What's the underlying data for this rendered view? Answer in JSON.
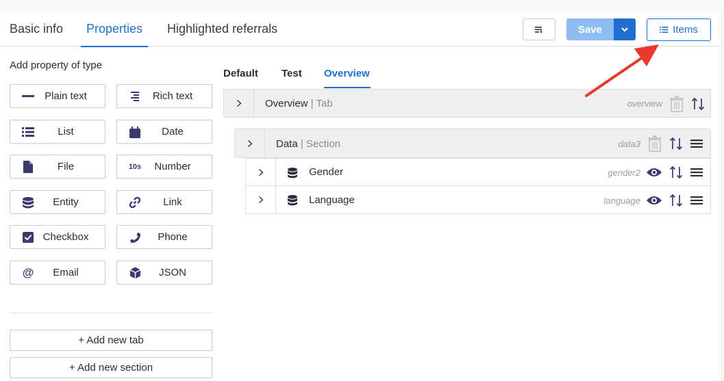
{
  "top_tabs": [
    "Basic info",
    "Properties",
    "Highlighted referrals"
  ],
  "toolbar": {
    "save_label": "Save",
    "items_label": "Items"
  },
  "left": {
    "title": "Add property of type",
    "types": [
      {
        "label": "Plain text",
        "icon": "minus-icon"
      },
      {
        "label": "Rich text",
        "icon": "align-right-icon"
      },
      {
        "label": "List",
        "icon": "list-icon"
      },
      {
        "label": "Date",
        "icon": "calendar-icon"
      },
      {
        "label": "File",
        "icon": "file-icon"
      },
      {
        "label": "Number",
        "icon": "number-icon",
        "icon_text": "10s"
      },
      {
        "label": "Entity",
        "icon": "database-icon"
      },
      {
        "label": "Link",
        "icon": "link-icon"
      },
      {
        "label": "Checkbox",
        "icon": "checkbox-icon"
      },
      {
        "label": "Phone",
        "icon": "phone-icon"
      },
      {
        "label": "Email",
        "icon": "at-icon"
      },
      {
        "label": "JSON",
        "icon": "cube-icon"
      }
    ],
    "add_tab": "+ Add new tab",
    "add_section": "+ Add new section"
  },
  "inner_tabs": [
    "Default",
    "Test",
    "Overview"
  ],
  "tree": {
    "tab": {
      "name": "Overview",
      "type": "Tab",
      "key": "overview"
    },
    "section": {
      "name": "Data",
      "type": "Section",
      "key": "data3"
    },
    "fields": [
      {
        "name": "Gender",
        "key": "gender2"
      },
      {
        "name": "Language",
        "key": "language"
      }
    ]
  },
  "colors": {
    "accent": "#1f6fd1",
    "save_disabled": "#8fbdf2",
    "icon": "#3a3a6e",
    "annotation_arrow": "#e8392c"
  }
}
